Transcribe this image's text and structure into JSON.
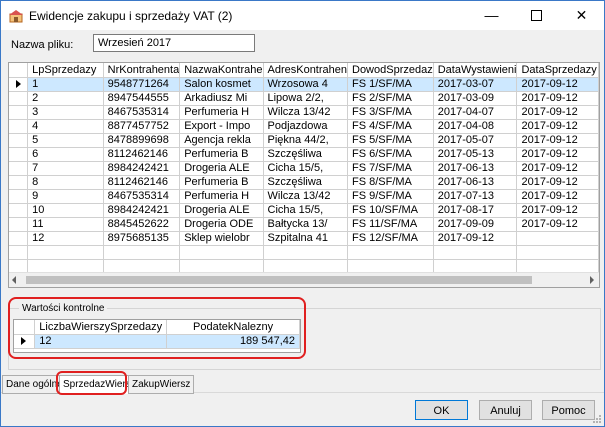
{
  "window": {
    "title": "Ewidencje zakupu i sprzedaży VAT (2)"
  },
  "file": {
    "label": "Nazwa pliku:",
    "value": "Wrzesień 2017"
  },
  "grid": {
    "columns": [
      "LpSprzedazy",
      "NrKontrahenta",
      "NazwaKontrahe",
      "AdresKontrahen",
      "DowodSprzedaz",
      "DataWystawieni",
      "DataSprzedazy"
    ],
    "rows": [
      [
        "1",
        "9548771264",
        "Salon kosmet",
        "Wrzosowa  4",
        "FS  1/SF/MA",
        "2017-03-07",
        "2017-09-12"
      ],
      [
        "2",
        "8947544555",
        "Arkadiusz Mi",
        "Lipowa  2/2,",
        "FS  2/SF/MA",
        "2017-03-09",
        "2017-09-12"
      ],
      [
        "3",
        "8467535314",
        "Perfumeria H",
        "Wilcza  13/42",
        "FS  3/SF/MA",
        "2017-04-07",
        "2017-09-12"
      ],
      [
        "4",
        "8877457752",
        "Export - Impo",
        "Podjazdowa",
        "FS  4/SF/MA",
        "2017-04-08",
        "2017-09-12"
      ],
      [
        "5",
        "8478899698",
        "Agencja rekla",
        "Piękna  44/2,",
        "FS  5/SF/MA",
        "2017-05-07",
        "2017-09-12"
      ],
      [
        "6",
        "8112462146",
        "Perfumeria B",
        "Szczęśliwa",
        "FS  6/SF/MA",
        "2017-05-13",
        "2017-09-12"
      ],
      [
        "7",
        "8984242421",
        "Drogeria ALE",
        "Cicha  15/5,",
        "FS  7/SF/MA",
        "2017-06-13",
        "2017-09-12"
      ],
      [
        "8",
        "8112462146",
        "Perfumeria B",
        "Szczęśliwa",
        "FS  8/SF/MA",
        "2017-06-13",
        "2017-09-12"
      ],
      [
        "9",
        "8467535314",
        "Perfumeria H",
        "Wilcza  13/42",
        "FS  9/SF/MA",
        "2017-07-13",
        "2017-09-12"
      ],
      [
        "10",
        "8984242421",
        "Drogeria ALE",
        "Cicha  15/5,",
        "FS 10/SF/MA",
        "2017-08-17",
        "2017-09-12"
      ],
      [
        "11",
        "8845452622",
        "Drogeria ODE",
        "Bałtycka  13/",
        "FS 11/SF/MA",
        "2017-09-09",
        "2017-09-12"
      ],
      [
        "12",
        "8975685135",
        "Sklep wielobr",
        "Szpitalna  41",
        "FS 12/SF/MA",
        "2017-09-12",
        ""
      ]
    ]
  },
  "control": {
    "legend": "Wartości kontrolne",
    "columns": [
      "LiczbaWierszySprzedazy",
      "PodatekNalezny"
    ],
    "row": [
      "12",
      "189 547,42"
    ]
  },
  "tabs": [
    "Dane ogólne",
    "SprzedazWiersz",
    "ZakupWiersz"
  ],
  "buttons": {
    "ok": "OK",
    "cancel": "Anuluj",
    "help": "Pomoc"
  },
  "colors": {
    "selection": "#cde8ff",
    "highlight": "#e02020"
  }
}
